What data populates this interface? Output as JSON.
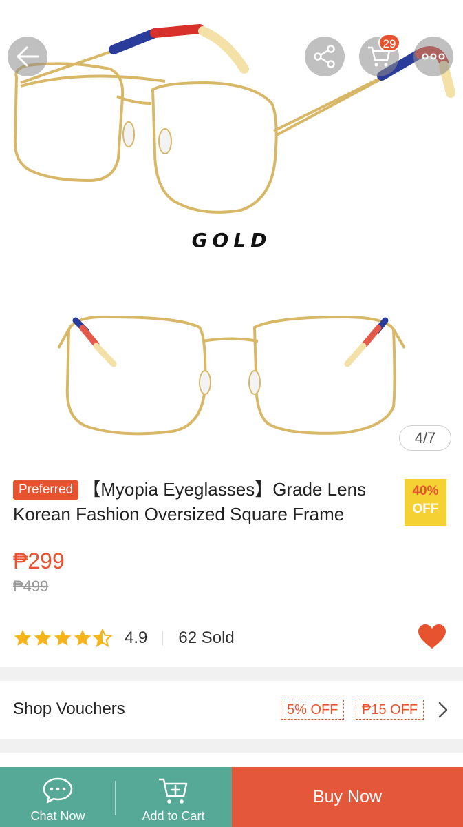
{
  "gallery": {
    "color_label": "GOLD",
    "page_indicator": "4/7",
    "cart_count": "29"
  },
  "product": {
    "badge": "Preferred",
    "title": "【Myopia Eyeglasses】Grade Lens Korean Fashion Oversized Square Frame",
    "discount_pct": "40%",
    "discount_off": "OFF",
    "price": "₱299",
    "original_price": "₱499",
    "rating": "4.9",
    "rating_value": 4.5,
    "sold": "62 Sold"
  },
  "vouchers": {
    "label": "Shop Vouchers",
    "tags": [
      "5% OFF",
      "₱15 OFF"
    ]
  },
  "bottom_bar": {
    "chat_label": "Chat Now",
    "cart_label": "Add to Cart",
    "buy_label": "Buy Now"
  },
  "colors": {
    "accent": "#e8532f",
    "bottom_green": "#57a997",
    "discount_yellow": "#f6d134",
    "star": "#f5b31c"
  },
  "icons": [
    "back-arrow-icon",
    "share-icon",
    "cart-icon",
    "more-icon",
    "heart-icon",
    "chat-icon",
    "add-cart-icon",
    "chevron-right-icon",
    "star-icon"
  ]
}
